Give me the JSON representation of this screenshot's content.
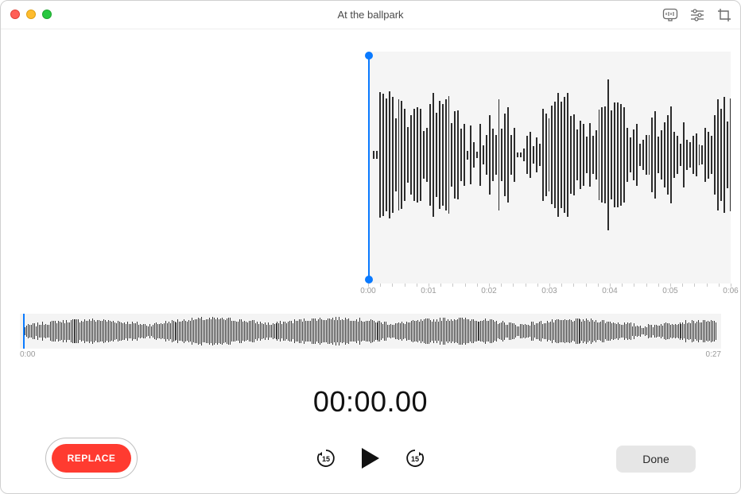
{
  "window": {
    "title": "At the ballpark"
  },
  "toolbar": {
    "transcribe_icon": "transcribe-icon",
    "settings_icon": "settings-icon",
    "trim_icon": "trim-icon"
  },
  "main_ruler": {
    "labels": [
      "0:00",
      "0:01",
      "0:02",
      "0:03",
      "0:04",
      "0:05",
      "0:06"
    ]
  },
  "overview": {
    "start_label": "0:00",
    "end_label": "0:27"
  },
  "timecode": "00:00.00",
  "buttons": {
    "replace": "REPLACE",
    "done": "Done",
    "skip_back_seconds": "15",
    "skip_fwd_seconds": "15"
  },
  "colors": {
    "accent": "#0a7aff",
    "record": "#ff3b30"
  }
}
